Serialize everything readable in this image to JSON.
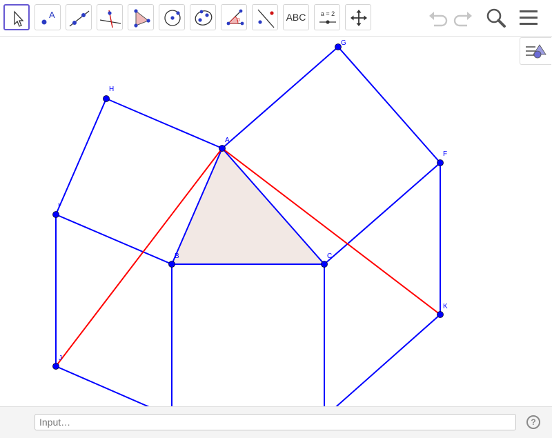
{
  "toolbar": {
    "tools": [
      {
        "name": "move-tool",
        "icon": "cursor-arrow-icon"
      },
      {
        "name": "point-tool",
        "icon": "point-icon",
        "label": "A"
      },
      {
        "name": "line-tool",
        "icon": "line-through-two-points-icon"
      },
      {
        "name": "perpendicular-line-tool",
        "icon": "perpendicular-line-icon"
      },
      {
        "name": "polygon-tool",
        "icon": "polygon-icon"
      },
      {
        "name": "circle-tool",
        "icon": "circle-center-point-icon"
      },
      {
        "name": "conic-tool",
        "icon": "ellipse-icon"
      },
      {
        "name": "angle-tool",
        "icon": "angle-icon",
        "label": "α"
      },
      {
        "name": "reflect-tool",
        "icon": "reflect-about-line-icon"
      },
      {
        "name": "text-tool",
        "icon": "text-icon",
        "label": "ABC"
      },
      {
        "name": "slider-tool",
        "icon": "slider-icon",
        "label": "a = 2"
      },
      {
        "name": "move-graphics-view-tool",
        "icon": "move-arrows-icon"
      }
    ],
    "right": [
      "undo-icon",
      "redo-icon",
      "search-icon",
      "menu-icon"
    ]
  },
  "style_bar": {
    "icon": "style-bar-toggle-icon"
  },
  "construction": {
    "triangle_fill": "#f2e8e4",
    "square_color": "#0000ff",
    "segment_color": "#ff0000",
    "point_color": "#0000ff",
    "points": [
      {
        "label": "A"
      },
      {
        "label": "B"
      },
      {
        "label": "C"
      },
      {
        "label": "F"
      },
      {
        "label": "G"
      },
      {
        "label": "H"
      },
      {
        "label": "I"
      },
      {
        "label": "J"
      },
      {
        "label": "K"
      }
    ]
  },
  "input_bar": {
    "placeholder": "Input…",
    "help_label": "?"
  }
}
